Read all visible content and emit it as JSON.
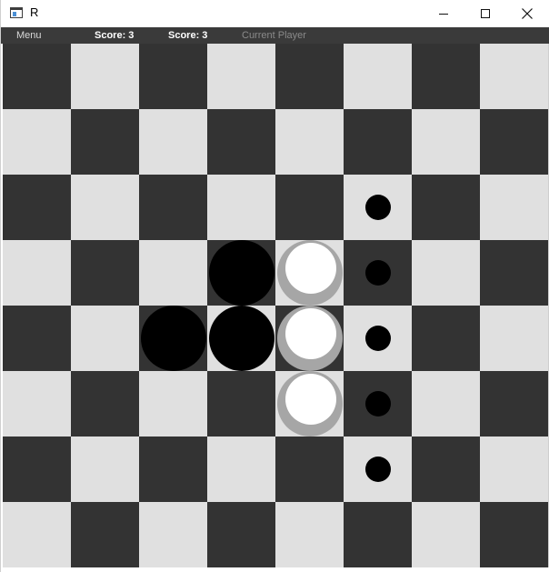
{
  "window": {
    "title": "R",
    "icon": "app-window-icon",
    "controls": [
      "minimize-icon",
      "maximize-icon",
      "close-icon"
    ]
  },
  "statusbar": {
    "menu_label": "Menu",
    "player1_score": "Score: 3",
    "player2_score": "Score: 3",
    "current_player_label": "Current Player"
  },
  "colors": {
    "dark_square": "#333333",
    "light_square": "#e0e0e0",
    "statusbar_bg": "#3a3a3a",
    "black_piece": "#000000",
    "white_piece": "#ffffff",
    "white_piece_shadow": "#a6a6a6"
  },
  "board": {
    "size": 8,
    "legend": "B = black piece, W = white piece, * = valid move hint, . = empty",
    "rows": [
      "........",
      "........",
      ".....*..",
      "...BW*..",
      "..BBW*..",
      "....W*..",
      ".....*..",
      "........"
    ]
  }
}
